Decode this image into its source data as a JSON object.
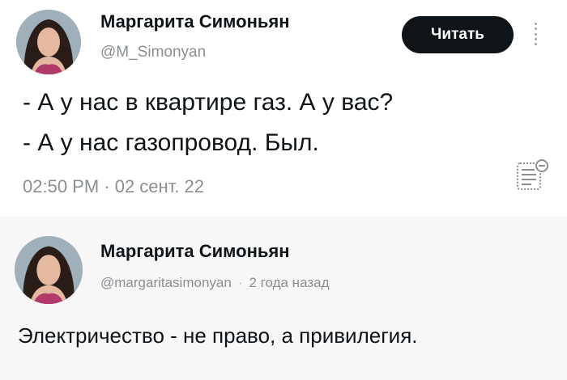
{
  "tweet": {
    "author_name": "Маргарита Симоньян",
    "author_handle": "@M_Simonyan",
    "read_button_label": "Читать",
    "text_line_1": "- А у нас в квартире газ. А у вас?",
    "text_line_2": "- А у нас газопровод. Был.",
    "timestamp": "02:50 PM · 02 сент. 22"
  },
  "reply": {
    "author_name": "Маргарита Симоньян",
    "author_handle": "@margaritasimonyan",
    "separator": "·",
    "relative_time": "2 года назад",
    "text": "Электричество - не право, а привилегия."
  },
  "icons": {
    "more": "vertical-dots-icon",
    "summary": "document-list-minus-icon"
  }
}
